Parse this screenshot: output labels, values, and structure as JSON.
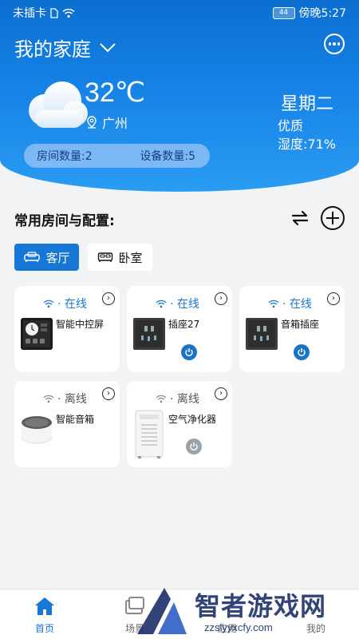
{
  "status_bar": {
    "carrier": "未插卡",
    "battery": "44",
    "time": "傍晚5:27"
  },
  "header": {
    "home_name": "我的家庭",
    "temperature": "32℃",
    "city": "广州",
    "weekday": "星期二",
    "air_quality": "优质",
    "humidity": "湿度:71%",
    "room_count": "房间数量:2",
    "device_count": "设备数量:5"
  },
  "section": {
    "title": "常用房间与配置:"
  },
  "rooms": [
    {
      "label": "客厅",
      "active": true
    },
    {
      "label": "卧室",
      "active": false
    }
  ],
  "devices": [
    {
      "name": "智能中控屏",
      "status": "· 在线",
      "online": true,
      "icon": "control-panel-icon"
    },
    {
      "name": "插座27",
      "status": "· 在线",
      "online": true,
      "icon": "socket-icon",
      "power": "on"
    },
    {
      "name": "音箱插座",
      "status": "· 在线",
      "online": true,
      "icon": "socket-icon",
      "power": "on"
    },
    {
      "name": "智能音箱",
      "status": "· 离线",
      "online": false,
      "icon": "speaker-icon"
    },
    {
      "name": "空气净化器",
      "status": "· 离线",
      "online": false,
      "icon": "air-purifier-icon",
      "power": "off"
    }
  ],
  "bottom_nav": [
    {
      "label": "首页",
      "active": true,
      "color": "#1677d6"
    },
    {
      "label": "场景",
      "active": false
    },
    {
      "label": "应用",
      "active": false
    },
    {
      "label": "我的",
      "active": false
    }
  ],
  "watermark": {
    "text": "智者游戏网",
    "url": "zzslyyxcfy.com"
  },
  "colors": {
    "accent": "#1677d6",
    "header_gradient_top": "#0c6fd0",
    "header_gradient_bottom": "#2a9cf2",
    "power_on": "#1a73c4",
    "power_off": "#9aa2aa"
  }
}
